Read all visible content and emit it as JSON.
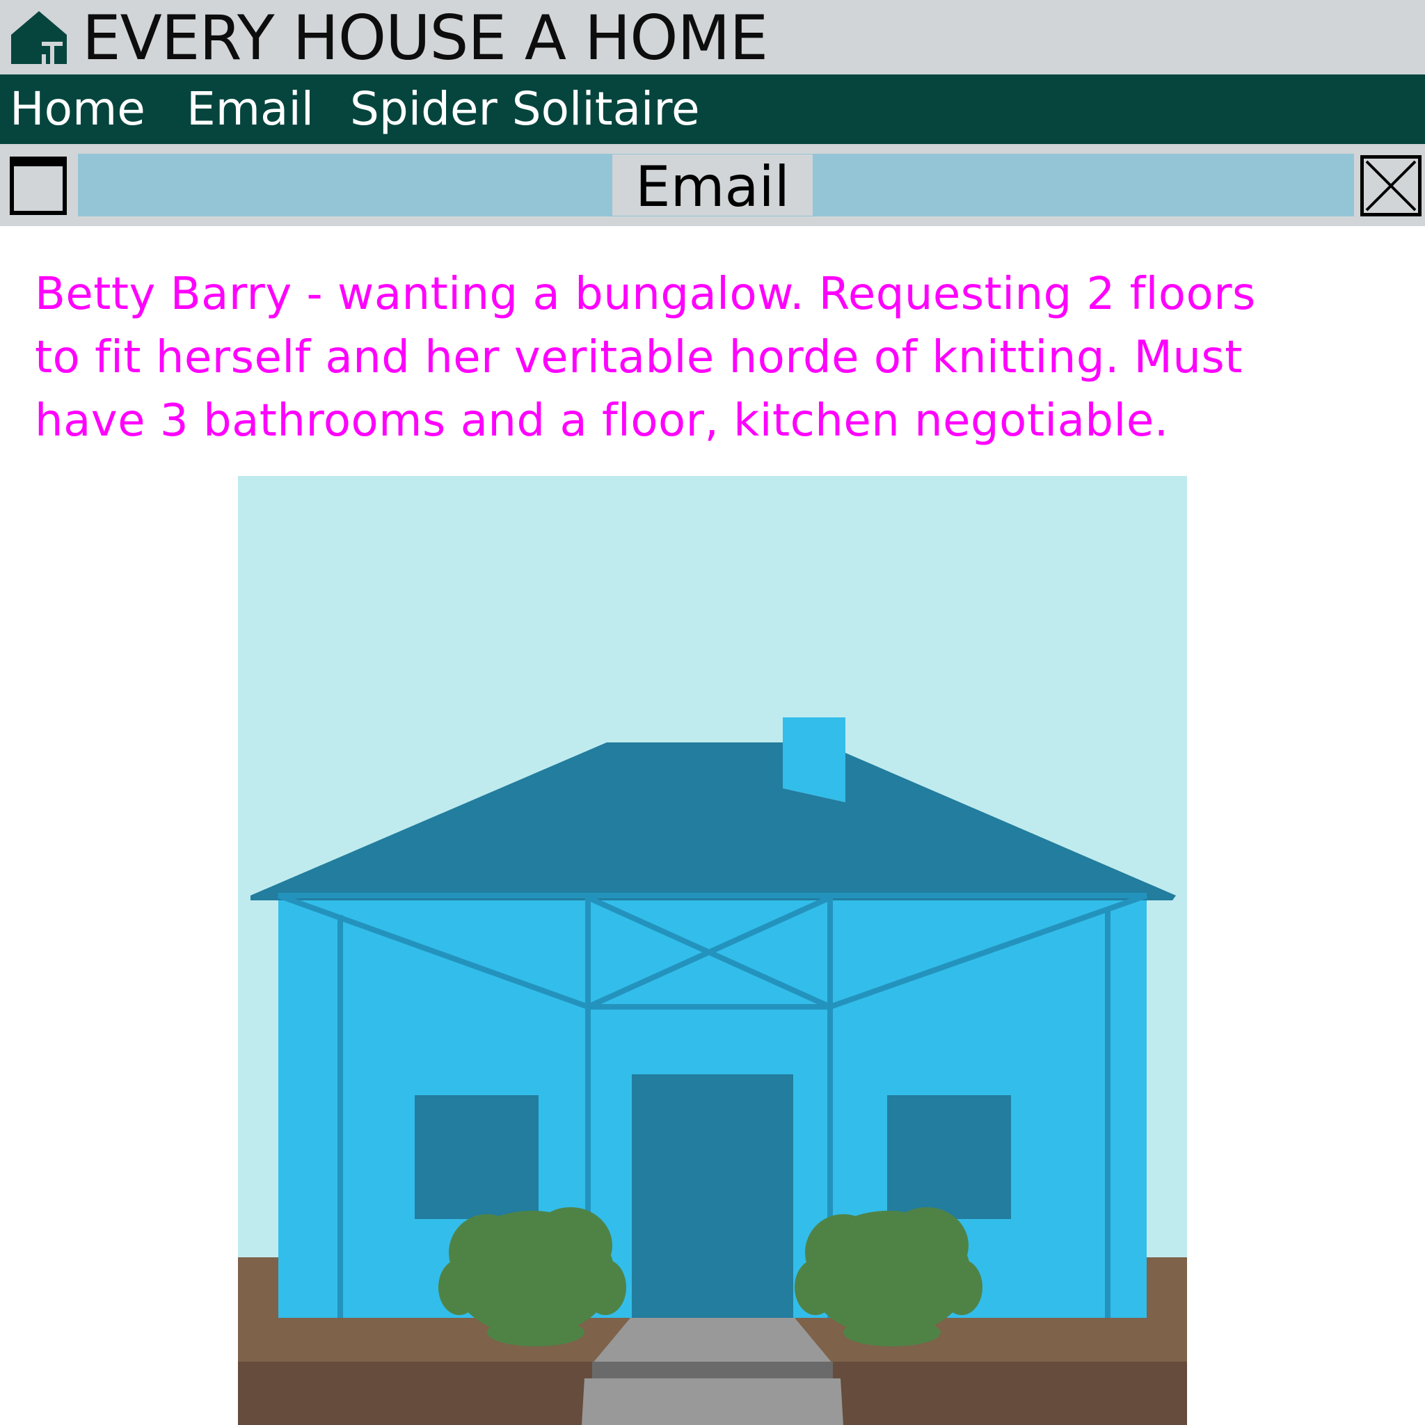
{
  "app": {
    "title": "EVERY HOUSE A HOME",
    "logo_icon": "house-logo-icon"
  },
  "nav": {
    "items": [
      {
        "label": "Home"
      },
      {
        "label": "Email"
      },
      {
        "label": "Spider Solitaire"
      }
    ]
  },
  "window": {
    "title": "Email",
    "maximize_icon": "maximize-window-icon",
    "close_icon": "close-icon"
  },
  "email": {
    "body_lines": [
      "Betty Barry - wanting a bungalow. Requesting 2 floors",
      "to fit herself and her veritable horde of knitting. Must",
      "have 3 bathrooms and a floor, kitchen negotiable."
    ],
    "text_color": "#ff00ff"
  },
  "colors": {
    "title_bar": "#d1d5d7",
    "nav_bar": "#06453e",
    "window_title_field": "#93c5d6",
    "sky": "#c0ebee",
    "house_wall": "#33bdea",
    "roof": "#227d9e",
    "ground": "#7e624a",
    "bush": "#4f8346"
  }
}
